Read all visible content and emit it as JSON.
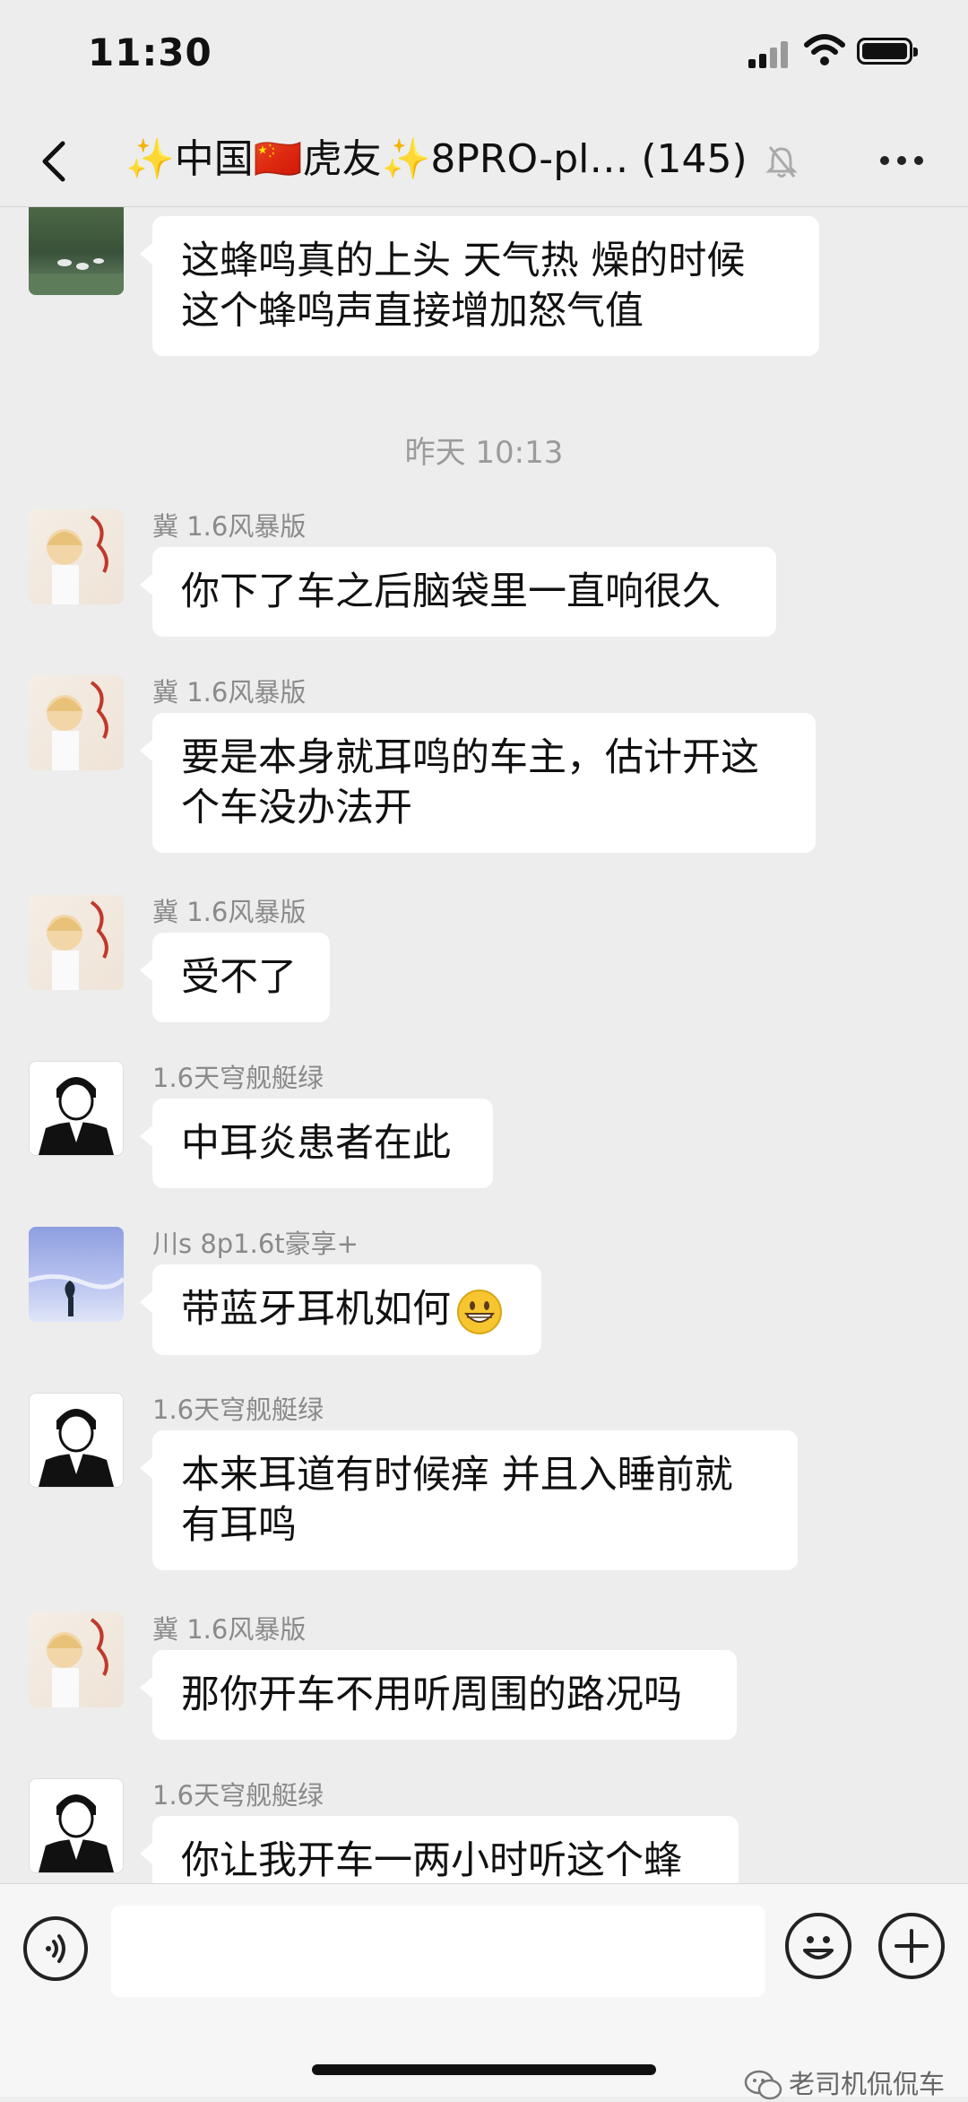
{
  "status_bar": {
    "time": "11:30"
  },
  "header": {
    "title": "✨中国🇨🇳虎友✨8PRO-pl…",
    "member_count": "(145)"
  },
  "chat": {
    "messages": [
      {
        "type": "text",
        "sender": "",
        "text": "这蜂鸣真的上头   天气热 燥的时候  这个蜂鸣声直接增加怒气值"
      },
      {
        "type": "time",
        "text": "昨天 10:13"
      },
      {
        "type": "text",
        "sender": "冀 1.6风暴版",
        "text": "你下了车之后脑袋里一直响很久"
      },
      {
        "type": "text",
        "sender": "冀 1.6风暴版",
        "text": "要是本身就耳鸣的车主，估计开这个车没办法开"
      },
      {
        "type": "text",
        "sender": "冀 1.6风暴版",
        "text": "受不了"
      },
      {
        "type": "text",
        "sender": "1.6天穹舰艇绿",
        "text": "中耳炎患者在此"
      },
      {
        "type": "text",
        "sender": "川s 8p1.6t豪享+",
        "text": "带蓝牙耳机如何",
        "emoji": "grinning-face"
      },
      {
        "type": "text",
        "sender": "1.6天穹舰艇绿",
        "text": "本来耳道有时候痒  并且入睡前就有耳鸣"
      },
      {
        "type": "text",
        "sender": "冀 1.6风暴版",
        "text": "那你开车不用听周围的路况吗"
      },
      {
        "type": "text",
        "sender": "1.6天穹舰艇绿",
        "text": "你让我开车一两小时听这个蜂鸣"
      }
    ]
  },
  "input_bar": {
    "placeholder": ""
  },
  "watermark": {
    "text": "老司机侃侃车"
  },
  "colors": {
    "background": "#ededed",
    "bubble": "#ffffff",
    "sender": "#8a8a8a",
    "text": "#111111"
  }
}
